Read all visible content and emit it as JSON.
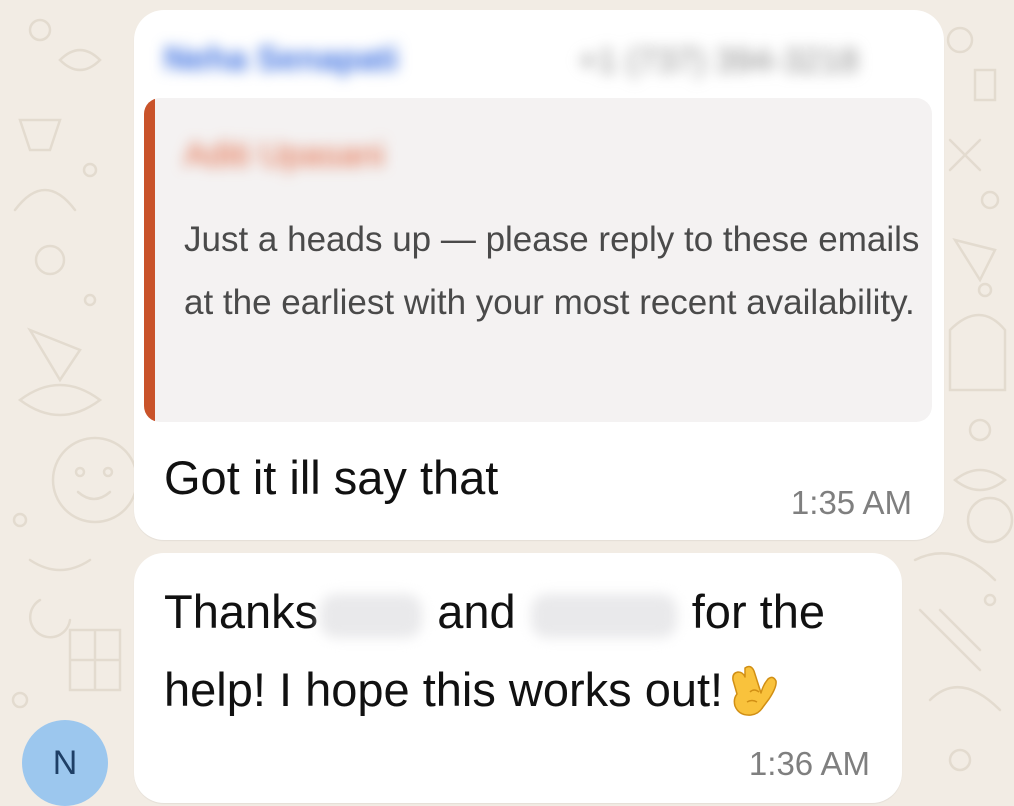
{
  "chat": {
    "messages": [
      {
        "sender_name": "Neha Senapati",
        "sender_phone": "+1 (737) 394-3218",
        "quote": {
          "author": "Aditi Upasani",
          "text": "Just a heads up — please reply to these emails at the earliest with your most recent availability."
        },
        "text": "Got it ill say that",
        "time": "1:35 AM"
      },
      {
        "text_part1": "Thanks",
        "text_part2": "and",
        "text_part3": "for the help! I hope this works out!",
        "emoji": "crossed-fingers",
        "time": "1:36 AM"
      }
    ]
  },
  "avatar": {
    "initial": "N",
    "color": "#9cc7ee"
  },
  "colors": {
    "background": "#f2ece4",
    "bubble": "#ffffff",
    "quote_bar": "#c9532a",
    "quote_author": "#e2643e",
    "sender_name": "#3b6fe0"
  }
}
